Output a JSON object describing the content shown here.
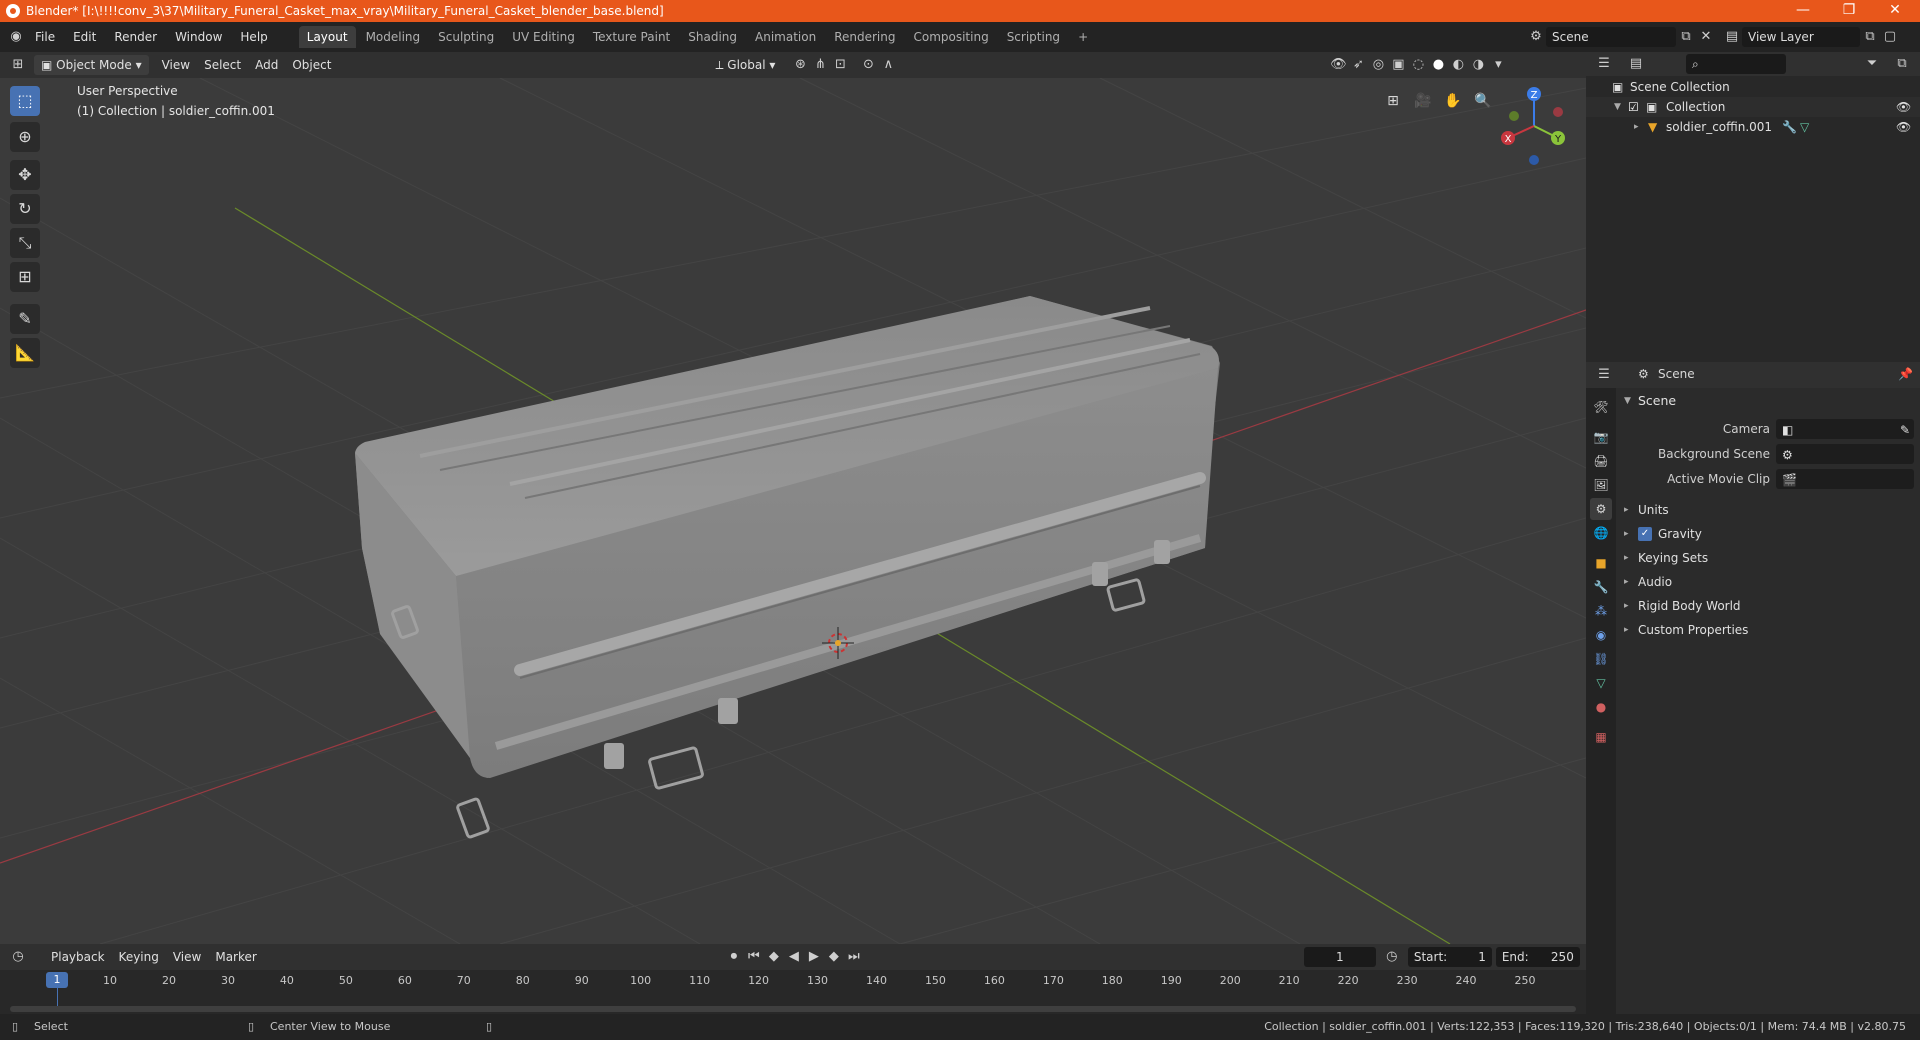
{
  "window": {
    "title": "Blender* [I:\\!!!!conv_3\\37\\Military_Funeral_Casket_max_vray\\Military_Funeral_Casket_blender_base.blend]",
    "minimize": "—",
    "maximize": "❐",
    "close": "✕"
  },
  "menubar": {
    "items": [
      "File",
      "Edit",
      "Render",
      "Window",
      "Help"
    ],
    "workspaces": [
      "Layout",
      "Modeling",
      "Sculpting",
      "UV Editing",
      "Texture Paint",
      "Shading",
      "Animation",
      "Rendering",
      "Compositing",
      "Scripting"
    ],
    "active_workspace": "Layout",
    "add_tab": "+",
    "scene_name": "Scene",
    "view_layer": "View Layer"
  },
  "viewport_header": {
    "mode": "Object Mode",
    "menus": [
      "View",
      "Select",
      "Add",
      "Object"
    ],
    "orientation": "Global"
  },
  "viewport": {
    "perspective": "User Perspective",
    "collection_info": "(1) Collection | soldier_coffin.001",
    "gizmo": {
      "x": "X",
      "y": "Y",
      "z": "Z"
    }
  },
  "outliner": {
    "scene_collection": "Scene Collection",
    "collection": "Collection",
    "object": "soldier_coffin.001"
  },
  "properties": {
    "context": "Scene",
    "panel_title": "Scene",
    "camera_label": "Camera",
    "background_scene_label": "Background Scene",
    "active_movie_clip_label": "Active Movie Clip",
    "sections": [
      "Units",
      "Gravity",
      "Keying Sets",
      "Audio",
      "Rigid Body World",
      "Custom Properties"
    ]
  },
  "timeline": {
    "menus": [
      "Playback",
      "Keying",
      "View",
      "Marker"
    ],
    "current_frame": "1",
    "start_label": "Start:",
    "start": "1",
    "end_label": "End:",
    "end": "250",
    "ticks": [
      "1",
      "10",
      "20",
      "30",
      "40",
      "50",
      "60",
      "70",
      "80",
      "90",
      "100",
      "110",
      "120",
      "130",
      "140",
      "150",
      "160",
      "170",
      "180",
      "190",
      "200",
      "210",
      "220",
      "230",
      "240",
      "250"
    ]
  },
  "statusbar": {
    "left_action": "Select",
    "mid_action": "Center View to Mouse",
    "stats": "Collection | soldier_coffin.001 | Verts:122,353 | Faces:119,320 | Tris:238,640 | Objects:0/1 | Mem: 74.4 MB | v2.80.75"
  },
  "colors": {
    "title_bar": "#e8571b",
    "accent": "#4772b3",
    "x_axis": "#c8373f",
    "y_axis": "#8bc43a",
    "z_axis": "#3b7ce8"
  }
}
